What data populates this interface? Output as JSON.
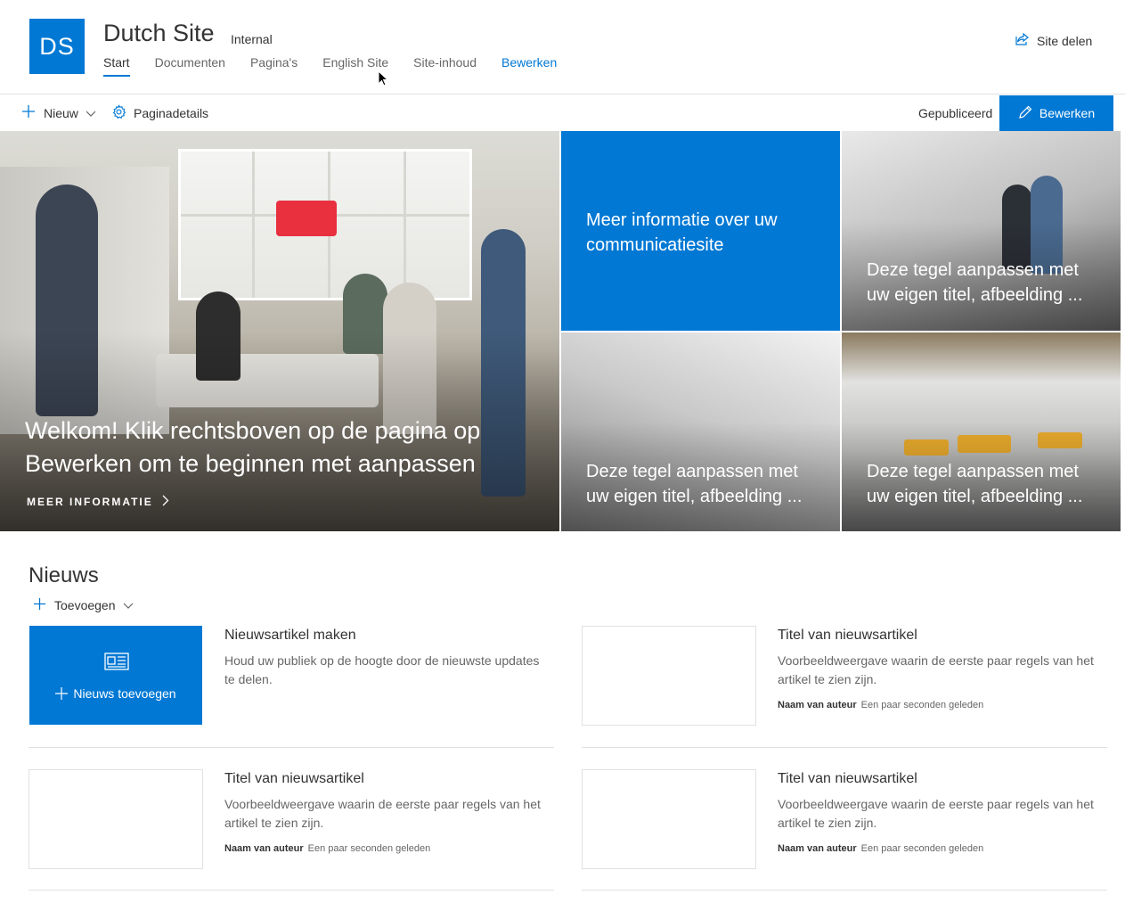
{
  "site": {
    "logo_initials": "DS",
    "title": "Dutch Site",
    "classification": "Internal",
    "share_label": "Site delen",
    "accent_color": "#0078d4"
  },
  "nav": {
    "items": [
      "Start",
      "Documenten",
      "Pagina's",
      "English Site",
      "Site-inhoud",
      "Bewerken"
    ],
    "active": "Start"
  },
  "commandbar": {
    "new_label": "Nieuw",
    "details_label": "Paginadetails",
    "status": "Gepubliceerd",
    "edit_label": "Bewerken"
  },
  "hero": {
    "main_title": "Welkom! Klik rechtsboven op de pagina op Bewerken om te beginnen met aanpassen",
    "main_link": "MEER INFORMATIE",
    "tiles": [
      {
        "title": "Meer informatie over uw communicatiesite"
      },
      {
        "title": "Deze tegel aanpassen met uw eigen titel, afbeelding ..."
      },
      {
        "title": "Deze tegel aanpassen met uw eigen titel, afbeelding ..."
      },
      {
        "title": "Deze tegel aanpassen met uw eigen titel, afbeelding ..."
      }
    ]
  },
  "news": {
    "section_title": "Nieuws",
    "add_label": "Toevoegen",
    "create_tile_label": "Nieuws toevoegen",
    "create_title": "Nieuwsartikel maken",
    "create_desc": "Houd uw publiek op de hoogte door de nieuwste updates te delen.",
    "articles": [
      {
        "title": "Titel van nieuwsartikel",
        "desc": "Voorbeeldweergave waarin de eerste paar regels van het artikel te zien zijn.",
        "author": "Naam van auteur",
        "time": "Een paar seconden geleden"
      },
      {
        "title": "Titel van nieuwsartikel",
        "desc": "Voorbeeldweergave waarin de eerste paar regels van het artikel te zien zijn.",
        "author": "Naam van auteur",
        "time": "Een paar seconden geleden"
      },
      {
        "title": "Titel van nieuwsartikel",
        "desc": "Voorbeeldweergave waarin de eerste paar regels van het artikel te zien zijn.",
        "author": "Naam van auteur",
        "time": "Een paar seconden geleden"
      }
    ]
  }
}
